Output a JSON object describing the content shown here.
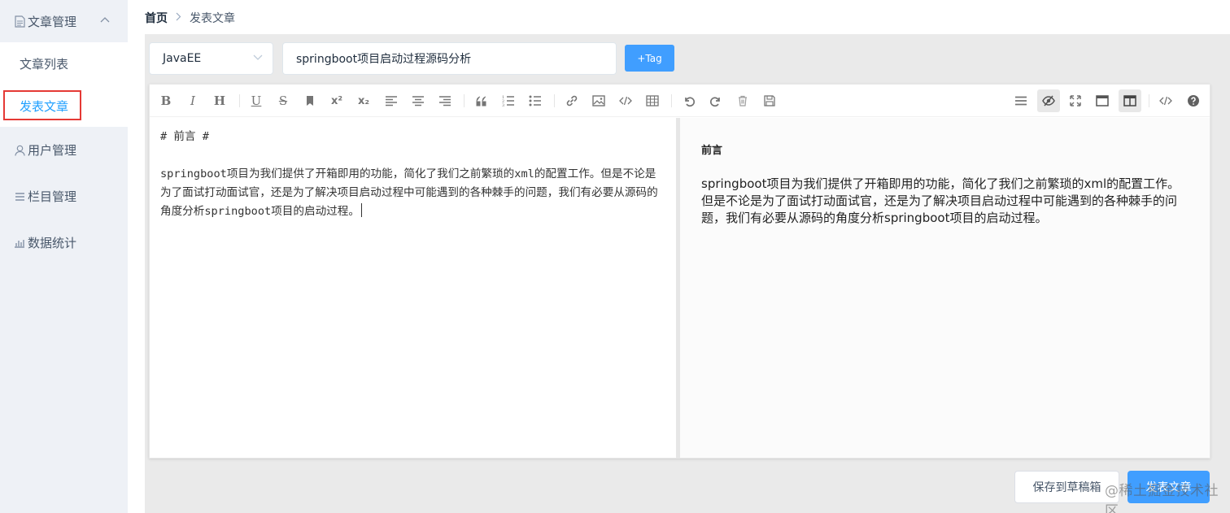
{
  "sidebar": {
    "article_group": {
      "label": "文章管理",
      "icon": "document-icon"
    },
    "article_items": [
      {
        "label": "文章列表"
      },
      {
        "label": "发表文章",
        "active": true
      }
    ],
    "items": [
      {
        "label": "用户管理",
        "icon": "user-icon"
      },
      {
        "label": "栏目管理",
        "icon": "list-icon"
      },
      {
        "label": "数据统计",
        "icon": "bar-chart-icon"
      }
    ]
  },
  "breadcrumb": {
    "home": "首页",
    "current": "发表文章"
  },
  "form": {
    "category": "JavaEE",
    "title": "springboot项目启动过程源码分析",
    "tag_button": "+Tag"
  },
  "editor": {
    "markdown_heading": "# 前言 #",
    "markdown_body": "springboot项目为我们提供了开箱即用的功能，简化了我们之前繁琐的xml的配置工作。但是不论是为了面试打动面试官，还是为了解决项目启动过程中可能遇到的各种棘手的问题，我们有必要从源码的角度分析springboot项目的启动过程。",
    "preview_heading": "前言",
    "preview_body": "springboot项目为我们提供了开箱即用的功能，简化了我们之前繁琐的xml的配置工作。但是不论是为了面试打动面试官，还是为了解决项目启动过程中可能遇到的各种棘手的问题，我们有必要从源码的角度分析springboot项目的启动过程。"
  },
  "actions": {
    "draft": "保存到草稿箱",
    "publish": "发表文章"
  },
  "watermark": "@稀土掘金技术社区",
  "colors": {
    "primary": "#409eff",
    "sidebar_bg": "#eef1f6",
    "active_text": "#20a0ff",
    "highlight_box": "#e53935"
  }
}
